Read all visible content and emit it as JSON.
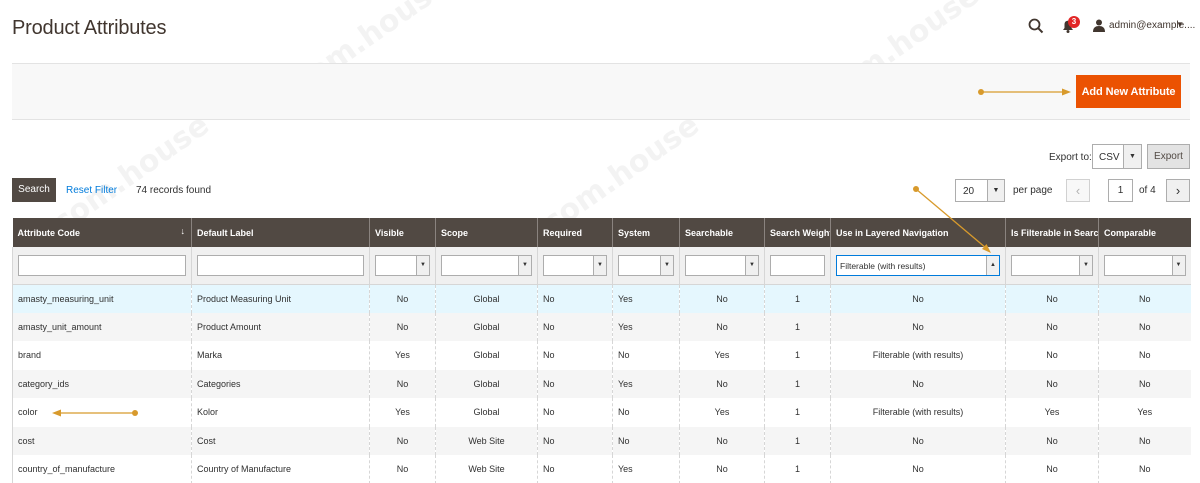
{
  "header": {
    "title": "Product Attributes",
    "notifications_count": "3",
    "username": "admin@example....",
    "icons": {
      "search": "search-icon",
      "notifications": "bell-icon",
      "user": "user-icon"
    }
  },
  "actions": {
    "add_new_label": "Add New Attribute",
    "accent_color": "#eb5202"
  },
  "export": {
    "label": "Export to:",
    "format": "CSV",
    "button_label": "Export"
  },
  "toolbar": {
    "search_label": "Search",
    "reset_label": "Reset Filter",
    "records_text": "74 records found",
    "per_page_value": "20",
    "per_page_label": "per page",
    "current_page": "1",
    "of_pages": "of 4"
  },
  "grid": {
    "columns": [
      "Attribute Code",
      "Default Label",
      "Visible",
      "Scope",
      "Required",
      "System",
      "Searchable",
      "Search Weight",
      "Use in Layered Navigation",
      "Is Filterable in Search",
      "Comparable"
    ],
    "sort_indicator": "↓",
    "filters": {
      "layered_navigation": "Filterable (with results)"
    },
    "rows": [
      [
        "amasty_measuring_unit",
        "Product Measuring Unit",
        "No",
        "Global",
        "No",
        "Yes",
        "No",
        "1",
        "No",
        "No",
        "No"
      ],
      [
        "amasty_unit_amount",
        "Product Amount",
        "No",
        "Global",
        "No",
        "Yes",
        "No",
        "1",
        "No",
        "No",
        "No"
      ],
      [
        "brand",
        "Marka",
        "Yes",
        "Global",
        "No",
        "No",
        "Yes",
        "1",
        "Filterable (with results)",
        "No",
        "No"
      ],
      [
        "category_ids",
        "Categories",
        "No",
        "Global",
        "No",
        "Yes",
        "No",
        "1",
        "No",
        "No",
        "No"
      ],
      [
        "color",
        "Kolor",
        "Yes",
        "Global",
        "No",
        "No",
        "Yes",
        "1",
        "Filterable (with results)",
        "Yes",
        "Yes"
      ],
      [
        "cost",
        "Cost",
        "No",
        "Web Site",
        "No",
        "No",
        "No",
        "1",
        "No",
        "No",
        "No"
      ],
      [
        "country_of_manufacture",
        "Country of Manufacture",
        "No",
        "Web Site",
        "No",
        "Yes",
        "No",
        "1",
        "No",
        "No",
        "No"
      ]
    ]
  },
  "watermark": "e-com.house"
}
